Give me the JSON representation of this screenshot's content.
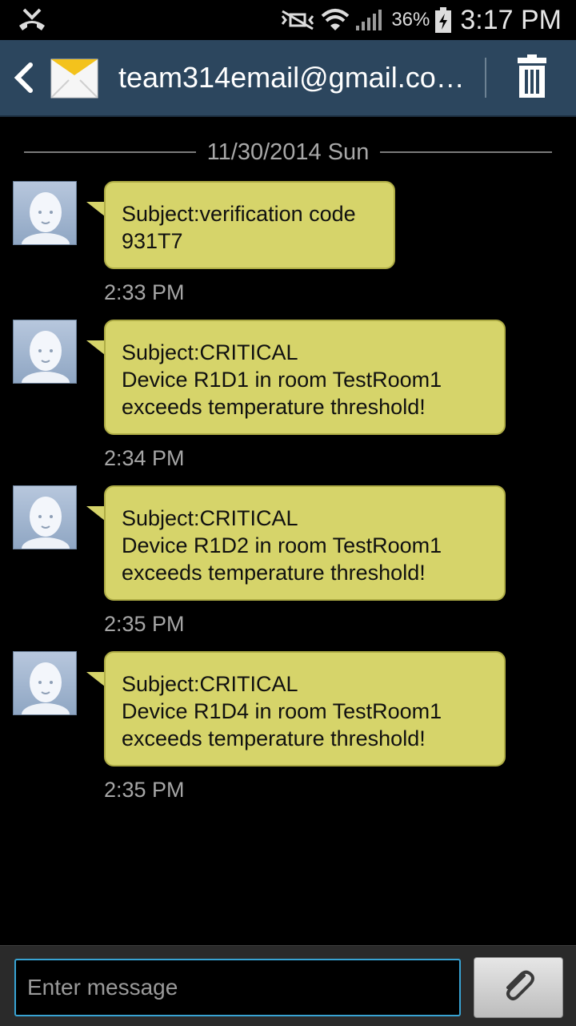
{
  "status_bar": {
    "battery_percent": "36%",
    "time": "3:17 PM",
    "icons": [
      "missed-call-icon",
      "mute-icon",
      "wifi-icon",
      "signal-icon",
      "battery-charging-icon"
    ]
  },
  "header": {
    "contact": "team314email@gmail.co…",
    "icons": [
      "back-icon",
      "email-icon",
      "trash-icon"
    ]
  },
  "date_separator": "11/30/2014 Sun",
  "messages": [
    {
      "lines": [
        "Subject:verification code",
        "931T7"
      ],
      "time": "2:33 PM"
    },
    {
      "lines": [
        "Subject:CRITICAL",
        "Device R1D1 in room TestRoom1",
        "exceeds temperature threshold!"
      ],
      "time": "2:34 PM"
    },
    {
      "lines": [
        "Subject:CRITICAL",
        "Device R1D2 in room TestRoom1",
        "exceeds temperature threshold!"
      ],
      "time": "2:35 PM"
    },
    {
      "lines": [
        "Subject:CRITICAL",
        "Device R1D4 in room TestRoom1",
        "exceeds temperature threshold!"
      ],
      "time": "2:35 PM"
    }
  ],
  "composer": {
    "placeholder": "Enter message",
    "attach_icon": "paperclip-icon"
  },
  "colors": {
    "action_bar": "#2c465e",
    "bubble": "#d6d46a",
    "input_border": "#38a3d3"
  }
}
